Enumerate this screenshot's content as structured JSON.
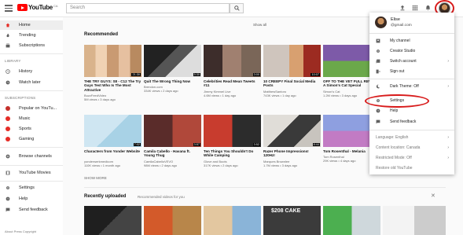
{
  "header": {
    "logo_text": "YouTube",
    "logo_sup": "CA",
    "search_placeholder": "Search"
  },
  "sidebar": {
    "items": [
      {
        "label": "Home",
        "icon": "home-icon"
      },
      {
        "label": "Trending",
        "icon": "flame-icon"
      },
      {
        "label": "Subscriptions",
        "icon": "subscriptions-icon"
      }
    ],
    "library_heading": "LIBRARY",
    "library": [
      {
        "label": "History",
        "icon": "history-icon"
      },
      {
        "label": "Watch later",
        "icon": "clock-icon"
      }
    ],
    "subscriptions_heading": "SUBSCRIPTIONS",
    "subscriptions": [
      {
        "label": "Popular on YouTu...",
        "color": "#c4302b"
      },
      {
        "label": "Music",
        "color": "#e52d27"
      },
      {
        "label": "Sports",
        "color": "#e52d27"
      },
      {
        "label": "Gaming",
        "color": "#e52d27"
      }
    ],
    "browse": "Browse channels",
    "movies": "YouTube Movies",
    "settings": "Settings",
    "help": "Help",
    "feedback": "Send feedback",
    "footer": "About  Press  Copyright"
  },
  "main": {
    "recommended": "Recommended",
    "show_all": "Show all",
    "show_more": "SHOW MORE",
    "recently_uploaded": "Recently uploaded",
    "recently_sub": "Recommended videos for you",
    "row1": [
      {
        "title": "THE TRY GUYS: S8 - C12 The Try Guys Test Who Is The Most Attractive",
        "meta": "BuzzFeedVideo\n5M views • 3 days ago",
        "dur": "21:30"
      },
      {
        "title": "Quit The Wrong Thing Now",
        "meta": "Brendon.com\n334K views • 2 days ago",
        "dur": "5:30"
      },
      {
        "title": "Celebrities Read Mean Tweets #11",
        "meta": "Jimmy Kimmel Live\n4.6M views • 1 day ago",
        "dur": "3:00"
      },
      {
        "title": "10 CREEPY Final Social Media Posts",
        "meta": "MatthewSantoro\n743K views • 1 day ago",
        "dur": "10:07"
      },
      {
        "title": "OFF TO THE VET FULL REVEAL - A Simon's Cat Special",
        "meta": "Simon's Cat\n1.2M views • 3 days ago",
        "dur": "4:15"
      }
    ],
    "row2": [
      {
        "title": "Characters from Yonder Website",
        "meta": "yonderwerkmedicom\n110K views • 1 month ago",
        "dur": "7:02"
      },
      {
        "title": "Camila Cabello - Havana ft. Young Thug",
        "meta": "CamilaCabelloVEVO\n98M views • 2 days ago",
        "dur": "3:57"
      },
      {
        "title": "Ten Things You Shouldn't Do While Camping",
        "meta": "Glove and Boots\n317K views • 2 days ago",
        "dur": "3:52"
      },
      {
        "title": "Razer Phone Impressions! 120Hz!",
        "meta": "Marques Brownlee\n1.7M views • 3 days ago",
        "dur": "8:44"
      },
      {
        "title": "Tom Rosenthal - Melania",
        "meta": "Tom Rosenthal\n29K views • 4 days ago",
        "dur": "3:22"
      }
    ],
    "row3_text": "$208 CAKE"
  },
  "dropdown": {
    "name": "Elise",
    "email": "@gmail.com",
    "items": [
      {
        "label": "My channel",
        "icon": "person-icon"
      },
      {
        "label": "Creator Studio",
        "icon": "gear-icon"
      },
      {
        "label": "Switch account",
        "icon": "switch-account-icon"
      },
      {
        "label": "Sign out",
        "icon": "sign-out-icon"
      },
      {
        "label": "Dark Theme: Off",
        "icon": "moon-icon"
      },
      {
        "label": "Settings",
        "icon": "gear-icon"
      },
      {
        "label": "Help",
        "icon": "help-icon"
      },
      {
        "label": "Send feedback",
        "icon": "feedback-icon"
      }
    ],
    "language": "Language: English",
    "location": "Content location: Canada",
    "restricted": "Restricted Mode: Off",
    "restore": "Restore old YouTube"
  },
  "colors": {
    "red": "#ff0000",
    "annotation": "#d81b1b"
  }
}
